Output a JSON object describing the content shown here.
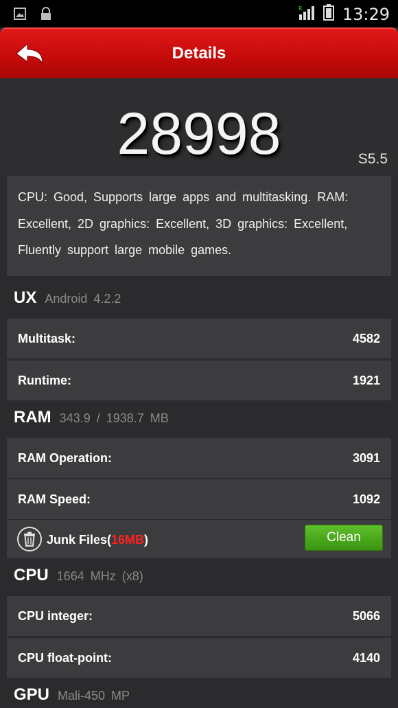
{
  "status_bar": {
    "time": "13:29"
  },
  "header": {
    "title": "Details"
  },
  "score": {
    "value": "28998",
    "version": "S5.5"
  },
  "description": "CPU: Good, Supports large apps and multitasking. RAM: Excellent, 2D graphics: Excellent, 3D graphics: Excellent, Fluently support large mobile games.",
  "ux": {
    "title": "UX",
    "sub": "Android 4.2.2",
    "rows": [
      {
        "label": "Multitask:",
        "value": "4582"
      },
      {
        "label": "Runtime:",
        "value": "1921"
      }
    ]
  },
  "ram": {
    "title": "RAM",
    "sub": "343.9 / 1938.7 MB",
    "rows": [
      {
        "label": "RAM Operation:",
        "value": "3091"
      },
      {
        "label": "RAM Speed:",
        "value": "1092"
      }
    ],
    "junk": {
      "prefix": "Junk Files(",
      "size": "16MB",
      "suffix": ")",
      "button": "Clean"
    }
  },
  "cpu": {
    "title": "CPU",
    "sub": "1664 MHz (x8)",
    "rows": [
      {
        "label": "CPU integer:",
        "value": "5066"
      },
      {
        "label": "CPU float-point:",
        "value": "4140"
      }
    ]
  },
  "gpu": {
    "title": "GPU",
    "sub": "Mali-450 MP"
  },
  "colors": {
    "header_red": "#c40a0a",
    "clean_green": "#4aa81c",
    "junk_red": "#ff2020"
  },
  "icons": [
    "image-icon",
    "lock-icon",
    "signal-icon",
    "battery-icon",
    "back-arrow-icon",
    "trash-icon"
  ]
}
